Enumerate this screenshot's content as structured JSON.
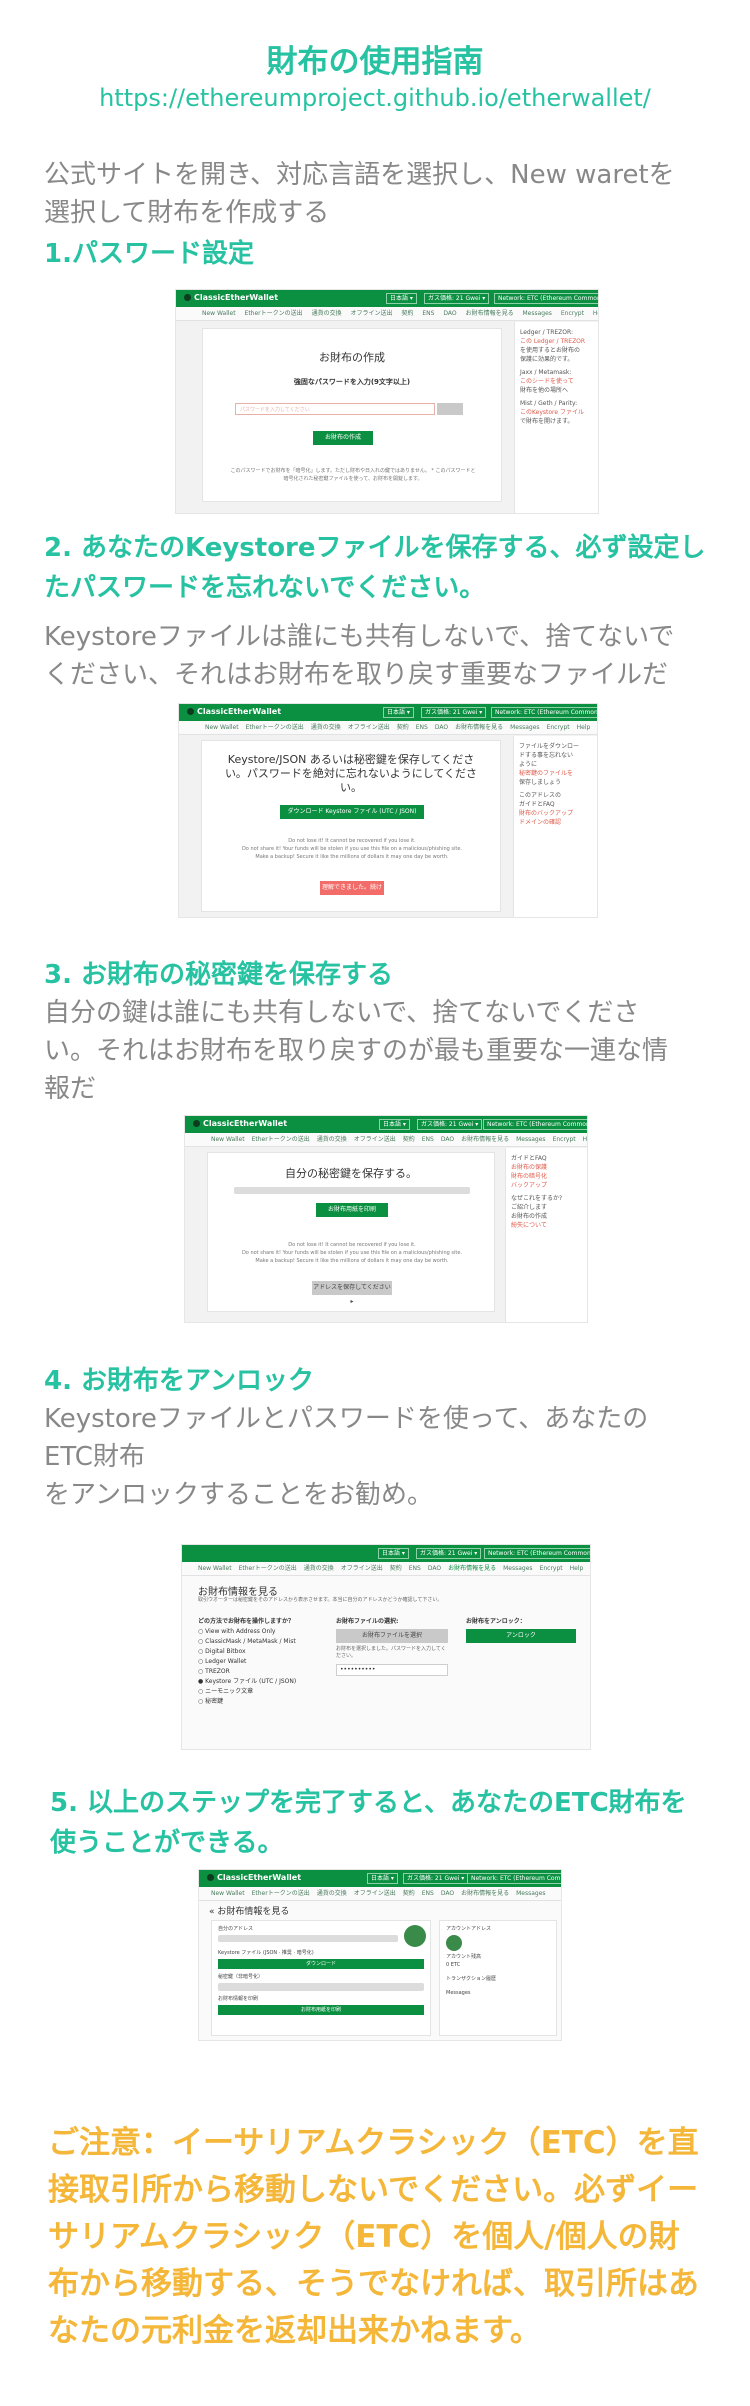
{
  "header": {
    "title": "財布の使用指南",
    "url": "https://ethereumproject.github.io/etherwallet/"
  },
  "intro": {
    "line1": "公式サイトを開き、対応言語を選択し、New waretを",
    "line2": "選択して財布を作成する"
  },
  "steps": {
    "s1": {
      "heading": "1.パスワード設定"
    },
    "s2": {
      "heading1": "2. あなたのKeystoreファイルを保存する、必ず設定し",
      "heading2": "たパスワードを忘れないでください。",
      "body1": "Keystoreファイルは誰にも共有しないで、捨てないで",
      "body2": "ください、それはお財布を取り戻す重要なファイルだ"
    },
    "s3": {
      "heading": "3. お財布の秘密鍵を保存する",
      "body1": "自分の鍵は誰にも共有しないで、捨てないでくださ",
      "body2": "い。それはお財布を取り戻すのが最も重要な一連な情",
      "body3": "報だ"
    },
    "s4": {
      "heading": "4. お財布をアンロック",
      "body1": "Keystoreファイルとパスワードを使って、あなたの",
      "body2": "ETC財布",
      "body3": "をアンロックすることをお勧め。"
    },
    "s5": {
      "heading1": "5. 以上のステップを完了すると、あなたのETC財布を",
      "heading2": "使うことができる。"
    }
  },
  "notice": {
    "line1": "ご注意：イーサリアムクラシック（ETC）を直",
    "line2": "接取引所から移動しないでください。必ずイー",
    "line3": "サリアムクラシック（ETC）を個人/個人の財",
    "line4": "布から移動する、そうでなければ、取引所はあ",
    "line5": "なたの元利金を返却出来かねます。"
  },
  "app": {
    "logo": "ClassicEtherWallet",
    "lang": "日本語 ▾",
    "gas": "ガス価格: 21 Gwei ▾",
    "network": "Network: ETC (Ethereum Commonwealth Parity) ▾",
    "nav": [
      "New Wallet",
      "Etherトークンの送出",
      "通貨の交換",
      "オフライン送出",
      "契約",
      "ENS",
      "DAO",
      "お財布情報を見る",
      "Messages",
      "Encrypt",
      "Help"
    ],
    "s1": {
      "card_title": "お財布の作成",
      "pw_label": "強固なパスワードを入力(9文字以上)",
      "pw_placeholder": "パスワードを入力してください",
      "create_btn": "お財布の作成",
      "note1": "このパスワードでお財布を「暗号化」します。ただし財布や日入れの鍵ではありません。 * このパスワードと",
      "note2": "暗号化された秘密鍵ファイルを使って、お財布を開錠します。",
      "side": [
        "Ledger / TREZOR:",
        "この Ledger / TREZOR",
        "を使用するとお財布の",
        "保護に効果的です。",
        "Jaxx / Metamask:",
        "このシードを使って",
        "財布を他の場所へ",
        "Mist / Geth / Parity:",
        "このKeystore ファイル",
        "で財布を開けます。"
      ]
    },
    "s2": {
      "card_title1": "Keystore/JSON あるいは秘密鍵を保存してくださ",
      "card_title2": "い。パスワードを絶対に忘れないようにしてくださ",
      "card_title3": "い。",
      "download_btn": "ダウンロード Keystore ファイル (UTC / JSON)",
      "note1": "Do not lose it! It cannot be recovered if you lose it.",
      "note2": "Do not share it! Your funds will be stolen if you use this file on a malicious/phishing site.",
      "note3": "Make a backup! Secure it like the millions of dollars it may one day be worth.",
      "continue_btn": "理解できました。続けます。",
      "side": [
        "ファイルをダウンロー",
        "ドする事を忘れない",
        "ように",
        "秘密鍵のファイルを",
        "保存しましょう",
        "このアドレスの",
        "ガイドとFAQ",
        "財布のバックアップ",
        "ドメインの確認"
      ]
    },
    "s3": {
      "card_title": "自分の秘密鍵を保存する。",
      "print_btn": "お財布用紙を印刷",
      "note1": "Do not lose it! It cannot be recovered if you lose it.",
      "note2": "Do not share it! Your funds will be stolen if you use this file on a malicious/phishing site.",
      "note3": "Make a backup! Secure it like the millions of dollars it may one day be worth.",
      "save_btn": "アドレスを保存してください ▸",
      "side": [
        "ガイドとFAQ",
        "お財布の保護",
        "財布の暗号化",
        "バックアップ",
        "なぜこれをするか?",
        "ご紹介します",
        "お財布の作成",
        "紛失について"
      ]
    },
    "s4": {
      "page_title": "お財布情報を見る",
      "desc": "取引ウオーターは秘密鍵をそのアドレスから表示させます。本当に自分のアドレスかどうか確認して下さい。",
      "choose_title": "どの方法でお財布を操作しますか？",
      "options": [
        "View with Address Only",
        "ClassicMask / MetaMask / Mist",
        "Digital Bitbox",
        "Ledger Wallet",
        "TREZOR",
        "Keystore ファイル (UTC / JSON)",
        "ニーモニック文章",
        "秘密鍵"
      ],
      "file_title": "お財布ファイルの選択:",
      "file_btn": "お財布ファイルを選択",
      "pw_hint": "お財布を選択しました。パスワードを入力してください。",
      "pw_value": "••••••••••",
      "unlock_title": "お財布をアンロック：",
      "unlock_btn": "アンロック"
    },
    "s5": {
      "page_title": "« お財布情報を見る",
      "addr_label": "自分のアドレス",
      "key_label": "Keystore ファイル (JSON · 推奨 · 暗号化)",
      "key_btn": "ダウンロード",
      "pk_label": "秘密鍵（非暗号化）",
      "print_label": "お財布情報を印刷",
      "print_btn": "お財布用紙を印刷",
      "side": [
        "アカウントアドレス",
        "アカウント残高",
        "0 ETC",
        "トランザクション履歴",
        "Messages"
      ]
    }
  },
  "colors": {
    "teal": "#27c2a2",
    "gray_text": "#888888",
    "notice_amber": "#f4b73a",
    "app_green": "#0b8f41"
  }
}
